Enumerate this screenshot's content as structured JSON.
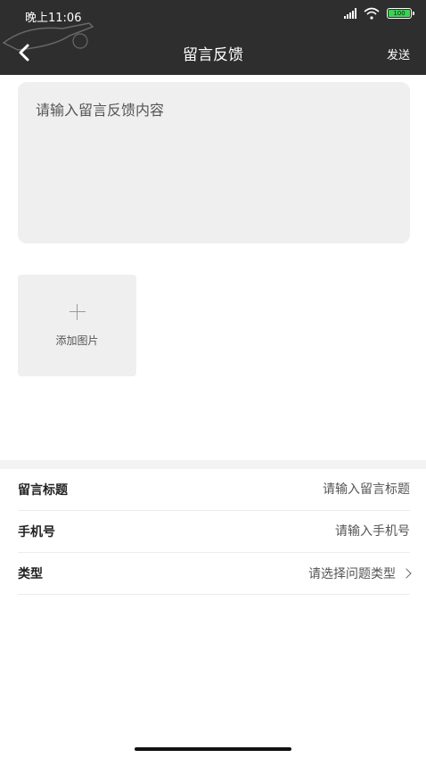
{
  "status_bar": {
    "time": "晚上11:06",
    "battery_text": "100"
  },
  "nav": {
    "title": "留言反馈",
    "send_label": "发送"
  },
  "feedback": {
    "placeholder": "请输入留言反馈内容"
  },
  "add_image": {
    "label": "添加图片"
  },
  "form": {
    "title_label": "留言标题",
    "title_placeholder": "请输入留言标题",
    "phone_label": "手机号",
    "phone_placeholder": "请输入手机号",
    "type_label": "类型",
    "type_placeholder": "请选择问题类型"
  },
  "icons": {
    "back": "back-arrow-icon",
    "signal": "signal-icon",
    "wifi": "wifi-icon",
    "battery": "battery-icon",
    "plus": "plus-icon",
    "chevron": "chevron-right-icon"
  },
  "colors": {
    "header_bg": "#2e2e2e",
    "battery_fill": "#39d353",
    "panel_bg": "#efefef"
  }
}
